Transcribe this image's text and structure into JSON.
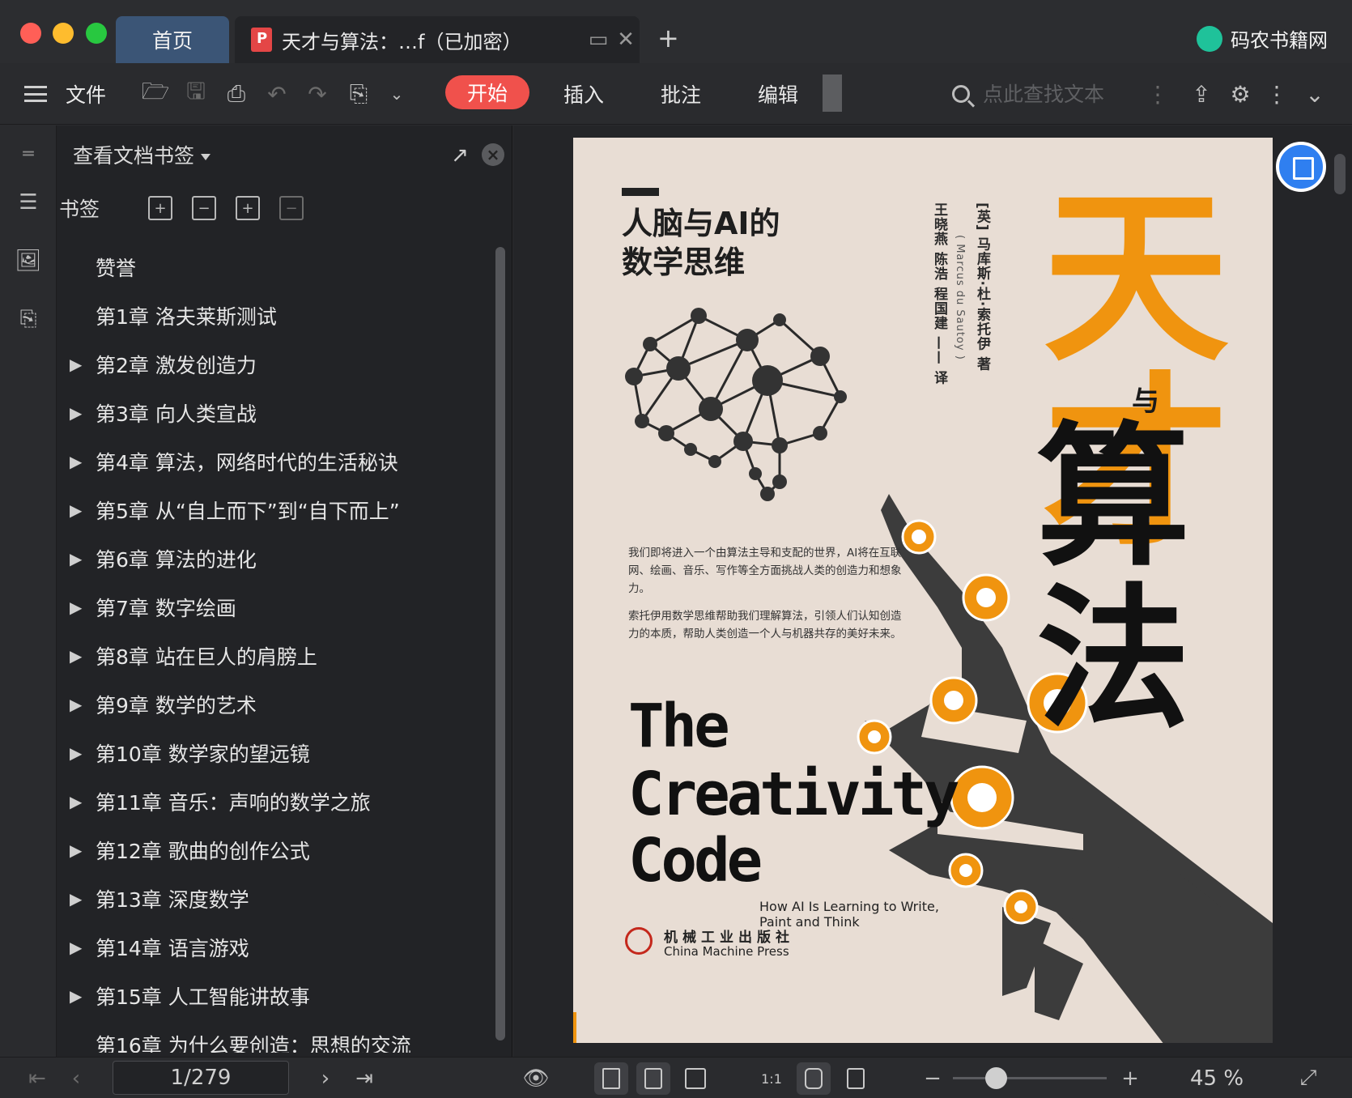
{
  "window": {
    "tabs": [
      {
        "label": "首页"
      },
      {
        "label": "天才与算法：…f（已加密）"
      }
    ],
    "brand": "码农书籍网"
  },
  "toolbar": {
    "file_label": "文件",
    "ribbon_tabs": [
      "开始",
      "插入",
      "批注",
      "编辑"
    ],
    "search_placeholder": "点此查找文本"
  },
  "sidebar": {
    "panel_title": "查看文档书签",
    "bookmark_label": "书签",
    "items": [
      {
        "label": "赞誉",
        "expandable": false
      },
      {
        "label": "第1章 洛夫莱斯测试",
        "expandable": false
      },
      {
        "label": "第2章 激发创造力",
        "expandable": true
      },
      {
        "label": "第3章 向人类宣战",
        "expandable": true
      },
      {
        "label": "第4章 算法，网络时代的生活秘诀",
        "expandable": true
      },
      {
        "label": "第5章 从“自上而下”到“自下而上”",
        "expandable": true
      },
      {
        "label": "第6章 算法的进化",
        "expandable": true
      },
      {
        "label": "第7章 数字绘画",
        "expandable": true
      },
      {
        "label": "第8章 站在巨人的肩膀上",
        "expandable": true
      },
      {
        "label": "第9章 数学的艺术",
        "expandable": true
      },
      {
        "label": "第10章 数学家的望远镜",
        "expandable": true
      },
      {
        "label": "第11章 音乐：声响的数学之旅",
        "expandable": true
      },
      {
        "label": "第12章 歌曲的创作公式",
        "expandable": true
      },
      {
        "label": "第13章 深度数学",
        "expandable": true
      },
      {
        "label": "第14章 语言游戏",
        "expandable": true
      },
      {
        "label": "第15章 人工智能讲故事",
        "expandable": true
      },
      {
        "label": "第16章 为什么要创造：思想的交流",
        "expandable": false
      }
    ]
  },
  "cover": {
    "subtitle": "人脑与AI的\n数学思维",
    "title_line1": "天才",
    "title_connector": "与",
    "title_line2": "算法",
    "author": "[英] 马库斯·杜·索托伊 著",
    "author_en": "( Marcus du Sautoy )",
    "translators": "王晓燕 陈浩 程国建 —— 译",
    "desc1": "我们即将进入一个由算法主导和支配的世界，AI将在互联网、绘画、音乐、写作等全方面挑战人类的创造力和想象力。",
    "desc2": "索托伊用数学思维帮助我们理解算法，引领人们认知创造力的本质，帮助人类创造一个人与机器共存的美好未来。",
    "en_title": [
      "The",
      "Creativity",
      "Code"
    ],
    "en_subtitle": "How AI Is Learning to Write,\nPaint and Think",
    "publisher_cn": "机械工业出版社",
    "publisher_en": "China Machine Press",
    "accent_color": "#f0940f"
  },
  "statusbar": {
    "page_value": "1/279",
    "zoom": "45 %"
  }
}
